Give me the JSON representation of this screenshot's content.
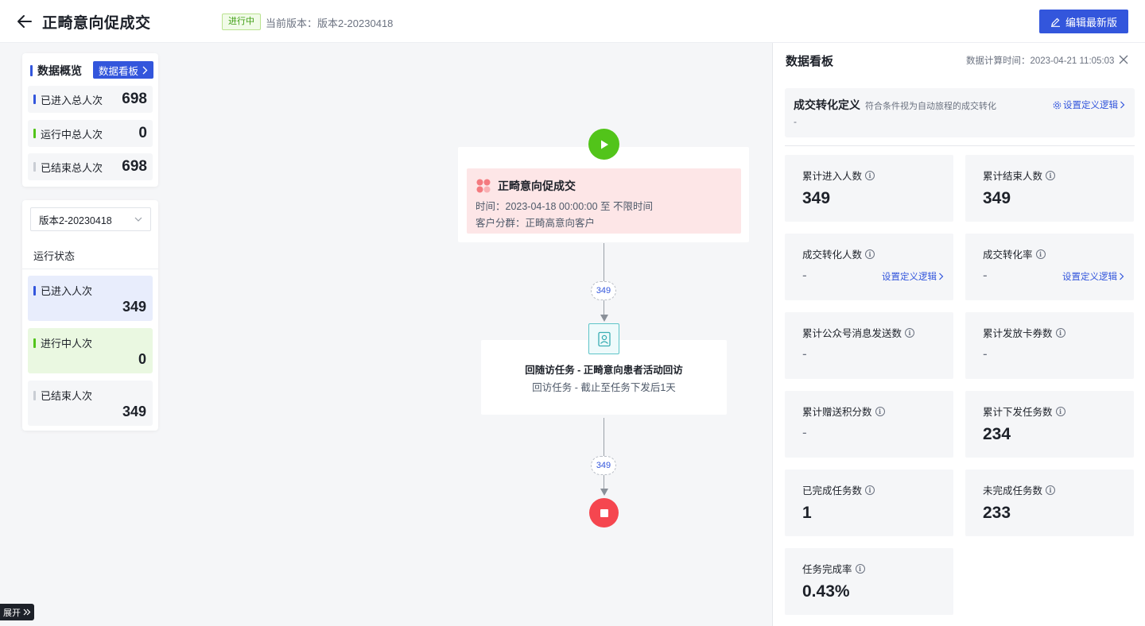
{
  "header": {
    "title": "正畸意向促成交",
    "status": "进行中",
    "version_text": "当前版本：版本2-20230418",
    "edit_button": "编辑最新版"
  },
  "overview": {
    "title": "数据概览",
    "dashboard_button": "数据看板",
    "rows": [
      {
        "label": "已进入总人次",
        "value": "698",
        "color": "#3356dc"
      },
      {
        "label": "运行中总人次",
        "value": "0",
        "color": "#52c41a"
      },
      {
        "label": "已结束总人次",
        "value": "698",
        "color": "#c9cdd4"
      }
    ]
  },
  "run_panel": {
    "version_select": "版本2-20230418",
    "title": "运行状态",
    "cards": [
      {
        "label": "已进入人次",
        "value": "349",
        "bg": "#e8edfc",
        "color": "#3356dc"
      },
      {
        "label": "进行中人次",
        "value": "0",
        "bg": "#eaf8e1",
        "color": "#52c41a"
      },
      {
        "label": "已结束人次",
        "value": "349",
        "bg": "#f5f6f8",
        "color": "#c9cdd4"
      }
    ]
  },
  "expand_button": "展开",
  "flow": {
    "trigger_title": "正畸意向促成交",
    "trigger_time": "时间：2023-04-18 00:00:00 至 不限时间",
    "trigger_group": "客户分群：正畸高意向客户",
    "count_1": "349",
    "task_title": "回随访任务 - 正畸意向患者活动回访",
    "task_sub": "回访任务 - 截止至任务下发后1天",
    "count_2": "349"
  },
  "dashboard": {
    "title": "数据看板",
    "calc_time": "数据计算时间：2023-04-21 11:05:03",
    "definition": {
      "title": "成交转化定义",
      "hint": "符合条件视为自动旅程的成交转化",
      "link": "设置定义逻辑",
      "value": "-"
    },
    "metrics": [
      {
        "label": "累计进入人数",
        "value": "349"
      },
      {
        "label": "累计结束人数",
        "value": "349"
      },
      {
        "label": "成交转化人数",
        "value": "-",
        "link": "设置定义逻辑"
      },
      {
        "label": "成交转化率",
        "value": "-",
        "link": "设置定义逻辑"
      },
      {
        "label": "累计公众号消息发送数",
        "value": "-"
      },
      {
        "label": "累计发放卡券数",
        "value": "-"
      },
      {
        "label": "累计赠送积分数",
        "value": "-"
      },
      {
        "label": "累计下发任务数",
        "value": "234"
      },
      {
        "label": "已完成任务数",
        "value": "1"
      },
      {
        "label": "未完成任务数",
        "value": "233"
      },
      {
        "label": "任务完成率",
        "value": "0.43%"
      }
    ]
  }
}
